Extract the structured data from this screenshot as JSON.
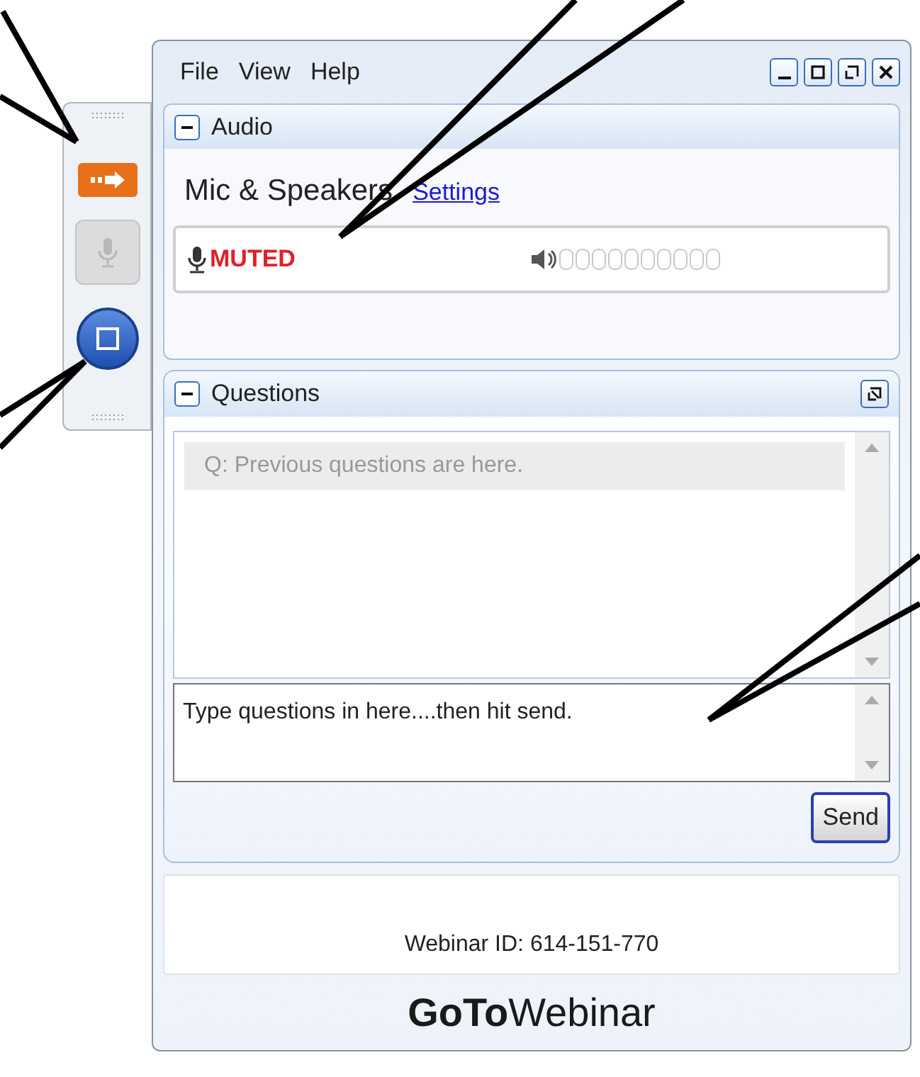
{
  "menu": [
    "File",
    "View",
    "Help"
  ],
  "dock": [
    {
      "kind": "arrow",
      "disabled": false
    },
    {
      "kind": "mic",
      "disabled": true
    },
    {
      "kind": "screen",
      "disabled": false
    }
  ],
  "audio": {
    "title": "Audio",
    "expanded": true,
    "mode": "Mic & Speakers",
    "settings_link": "Settings",
    "mic_status": "MUTED"
  },
  "questions": {
    "title": "Questions",
    "expanded": true,
    "history": [
      "Q: Previous questions are here."
    ],
    "input_value": "Type questions in here....then hit send.",
    "send_button": "Send"
  },
  "footer": {
    "webinar_id": "Webinar ID: 614-151-770",
    "logo_bold": "GoTo",
    "logo_light": "Webinar"
  }
}
